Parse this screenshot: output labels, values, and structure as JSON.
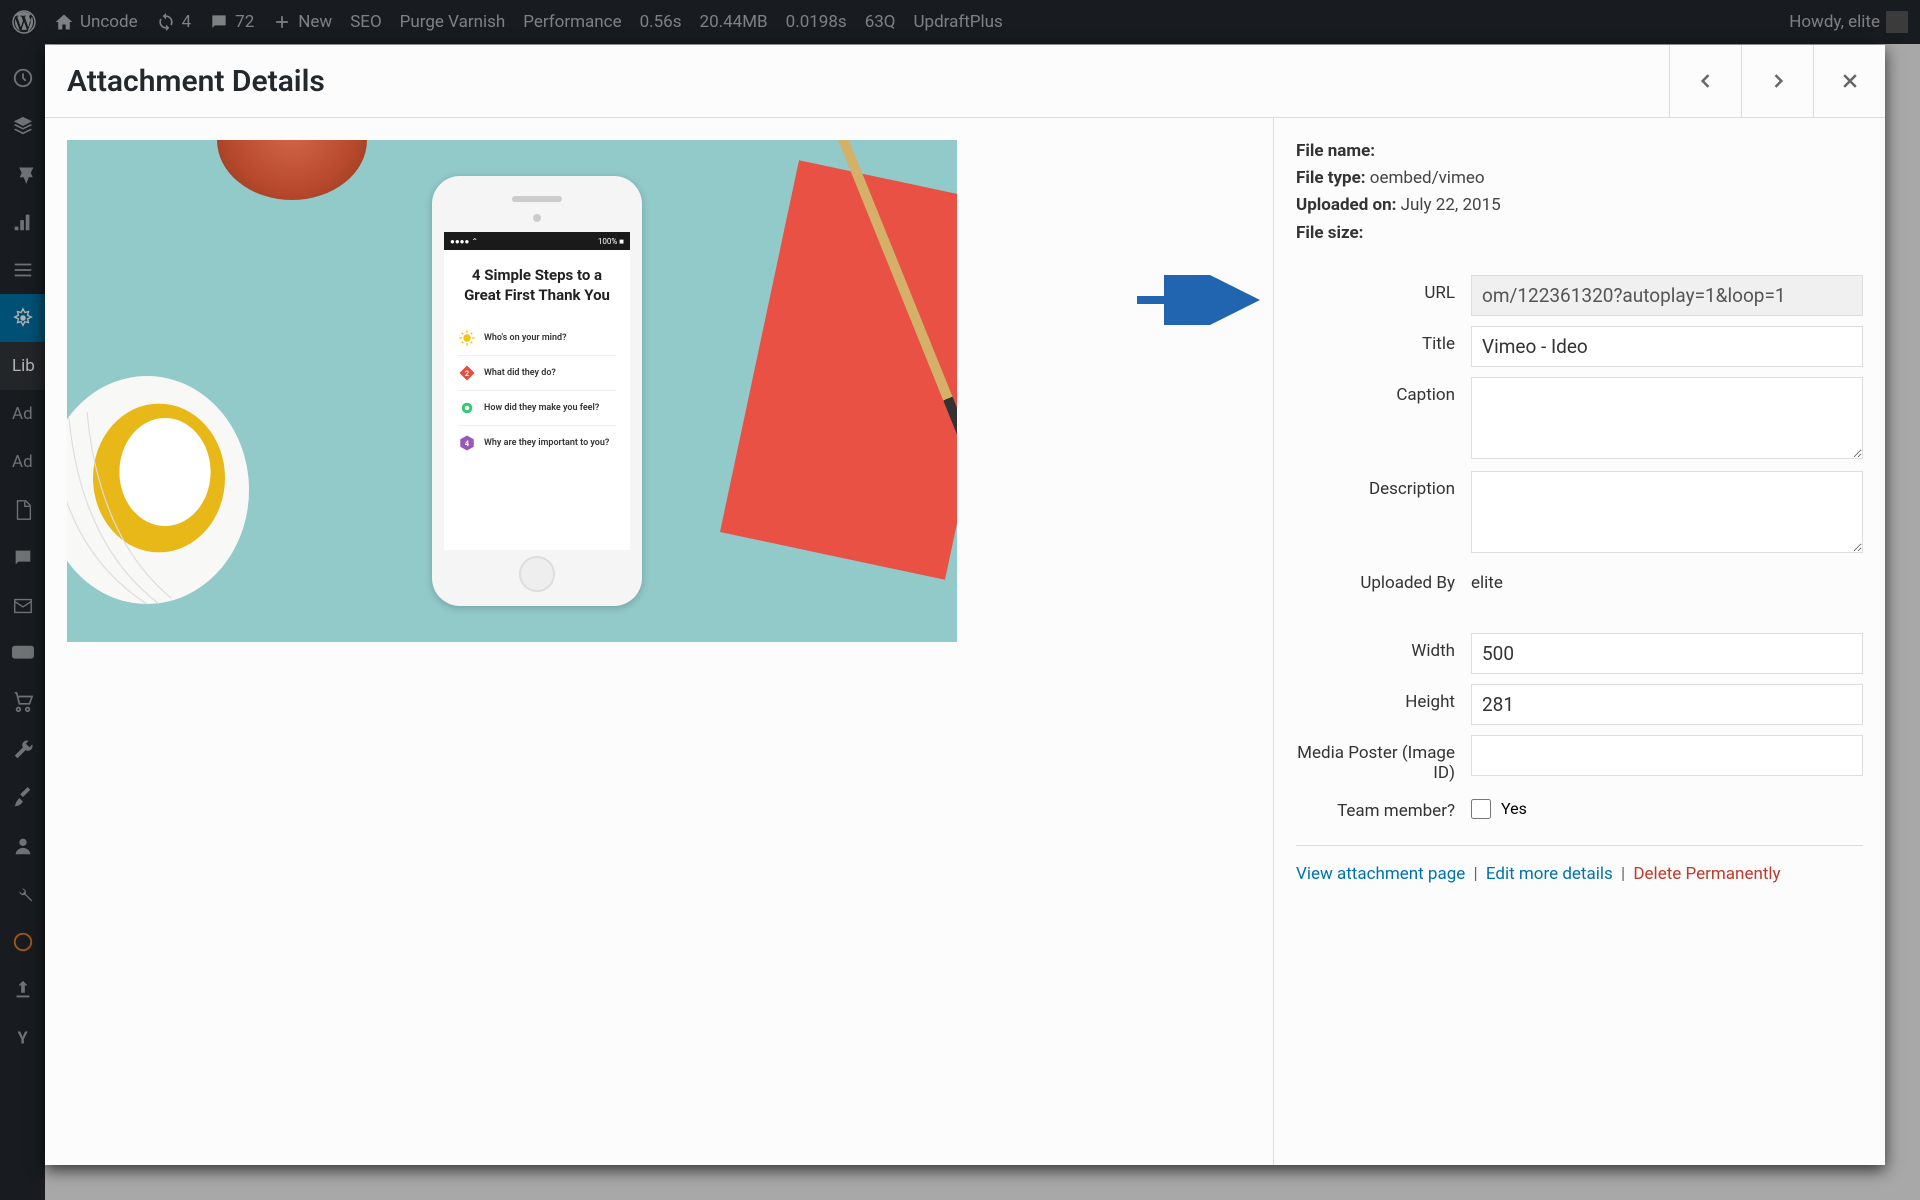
{
  "adminbar": {
    "site_name": "Uncode",
    "updates_count": "4",
    "comments_count": "72",
    "new_label": "New",
    "seo_label": "SEO",
    "purge_label": "Purge Varnish",
    "performance_label": "Performance",
    "time": "0.56s",
    "memory": "20.44MB",
    "db_time": "0.0198s",
    "queries": "63Q",
    "updraft": "UpdraftPlus",
    "howdy": "Howdy, elite"
  },
  "sidebar": {
    "labels": {
      "library": "Lib",
      "ad1": "Ad",
      "ad2": "Ad"
    }
  },
  "modal": {
    "title": "Attachment Details"
  },
  "preview": {
    "phone_heading": "4 Simple Steps to a Great First Thank You",
    "rows": [
      {
        "text": "Who's on your mind?"
      },
      {
        "text": "What did they do?"
      },
      {
        "text": "How did they make you feel?"
      },
      {
        "text": "Why are they important to you?"
      }
    ],
    "status_left": "●●●● ⌃",
    "status_right": "100% ■"
  },
  "details": {
    "file_name_label": "File name:",
    "file_name": "",
    "file_type_label": "File type:",
    "file_type": "oembed/vimeo",
    "uploaded_on_label": "Uploaded on:",
    "uploaded_on": "July 22, 2015",
    "file_size_label": "File size:",
    "file_size": "",
    "fields": {
      "url_label": "URL",
      "url_value": "om/122361320?autoplay=1&loop=1",
      "title_label": "Title",
      "title_value": "Vimeo - Ideo",
      "caption_label": "Caption",
      "caption_value": "",
      "description_label": "Description",
      "description_value": "",
      "uploaded_by_label": "Uploaded By",
      "uploaded_by_value": "elite",
      "width_label": "Width",
      "width_value": "500",
      "height_label": "Height",
      "height_value": "281",
      "media_poster_label": "Media Poster (Image ID)",
      "media_poster_value": "",
      "team_member_label": "Team member?",
      "team_member_yes": "Yes"
    },
    "links": {
      "view": "View attachment page",
      "edit": "Edit more details",
      "delete": "Delete Permanently"
    }
  }
}
